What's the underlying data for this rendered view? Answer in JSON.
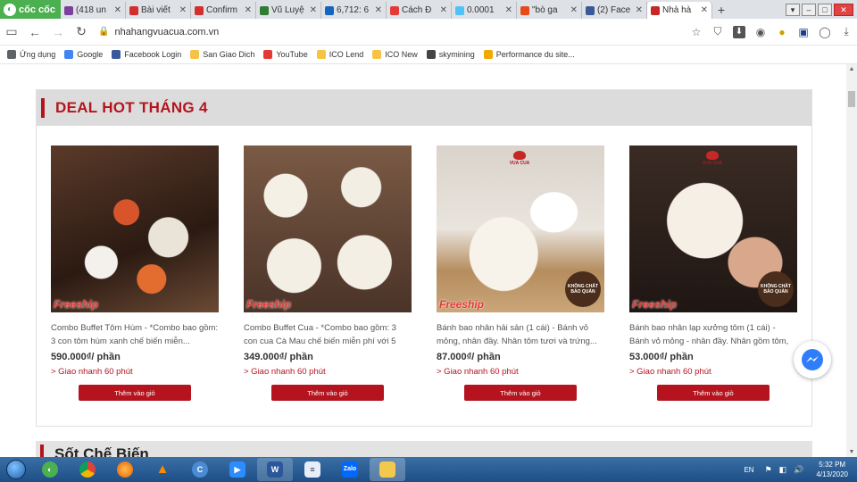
{
  "browser": {
    "brand": "cốc cốc",
    "tabs": [
      {
        "title": "(418 un",
        "color": "#7b3f9e"
      },
      {
        "title": "Bài viết",
        "color": "#d32f2f"
      },
      {
        "title": "Confirm",
        "color": "#d32f2f"
      },
      {
        "title": "Vũ Luyệ",
        "color": "#2e7d32"
      },
      {
        "title": "6,712: 6",
        "color": "#1565c0"
      },
      {
        "title": "Cách Đ",
        "color": "#e53935"
      },
      {
        "title": "0.0001",
        "color": "#4fc3f7"
      },
      {
        "title": "\"bò ga",
        "color": "#e64a19"
      },
      {
        "title": "(2) Face",
        "color": "#3b5998"
      },
      {
        "title": "Nhà hà",
        "color": "#c62828"
      }
    ],
    "active_tab_index": 9,
    "url": "nhahangvuacua.com.vn",
    "bookmarks": [
      {
        "label": "Ứng dụng",
        "color": "#5f6368"
      },
      {
        "label": "Google",
        "color": "#4285f4"
      },
      {
        "label": "Facebook Login",
        "color": "#3b5998"
      },
      {
        "label": "San Giao Dich",
        "color": "#f6c344"
      },
      {
        "label": "YouTube",
        "color": "#e53935"
      },
      {
        "label": "ICO Lend",
        "color": "#f6c344"
      },
      {
        "label": "ICO New",
        "color": "#f6c344"
      },
      {
        "label": "skymining",
        "color": "#444"
      },
      {
        "label": "Performance du site...",
        "color": "#f2a900"
      }
    ]
  },
  "page": {
    "section_title": "DEAL HOT THÁNG 4",
    "next_section_title": "Sốt Chế Biến",
    "products": [
      {
        "desc": "Combo Buffet Tôm Hùm - *Combo bao gồm: 3 con tôm hùm xanh chế biến miễn...",
        "price": "590.000₫/ phần",
        "delivery": "> Giao nhanh 60 phút",
        "button": "Thêm vào giỏ",
        "tag": "Freeship",
        "badge": ""
      },
      {
        "desc": "Combo Buffet Cua - *Combo bao gồm: 3 con cua Cà Mau chế biến miễn phí với 5 lo...",
        "price": "349.000₫/ phần",
        "delivery": "> Giao nhanh 60 phút",
        "button": "Thêm vào giỏ",
        "tag": "Freeship",
        "badge": ""
      },
      {
        "desc": "Bánh bao nhân hải sản (1 cái) - Bánh vỏ mỏng, nhân đầy. Nhân tôm tươi và trứng...",
        "price": "87.000₫/ phần",
        "delivery": "> Giao nhanh 60 phút",
        "button": "Thêm vào giỏ",
        "tag": "Freeship",
        "badge": "KHÔNG CHẤT BẢO QUẢN",
        "logo": "VUA CUA"
      },
      {
        "desc": "Bánh bao nhân lạp xưởng tôm (1 cái) - Bánh vỏ mỏng - nhân đầy. Nhân gồm tôm, thịt,...",
        "price": "53.000₫/ phần",
        "delivery": "> Giao nhanh 60 phút",
        "button": "Thêm vào giỏ",
        "tag": "Freeship",
        "badge": "KHÔNG CHẤT BẢO QUẢN",
        "logo": "VUA CUA"
      }
    ]
  },
  "taskbar": {
    "apps": [
      "coccoc",
      "chrome",
      "firefox",
      "vlc",
      "coccoc2",
      "zoom",
      "word",
      "notepad",
      "zalo",
      "explorer"
    ],
    "lang": "EN",
    "time": "5:32 PM",
    "date": "4/13/2020"
  },
  "colors": {
    "accent": "#b5141f",
    "tag": "#e53935"
  }
}
